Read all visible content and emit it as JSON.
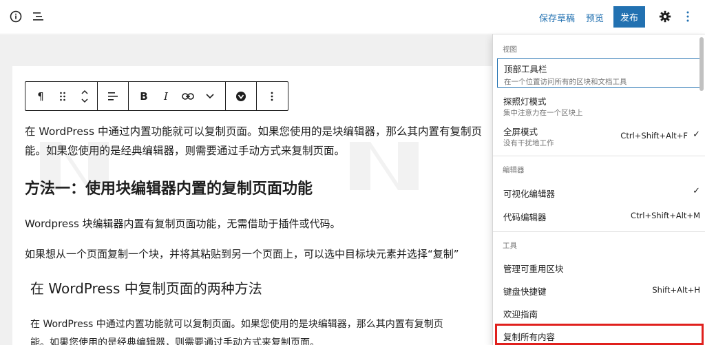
{
  "topbar": {
    "save_draft": "保存草稿",
    "preview": "预览",
    "publish": "发布",
    "icons": [
      "info-icon",
      "list-view-icon",
      "gear-icon",
      "more-vertical-icon"
    ]
  },
  "block_toolbar": {
    "paragraph_symbol": "¶",
    "bold": "B",
    "italic": "I"
  },
  "content": {
    "para1_line1": "在 WordPress 中通过内置功能就可以复制页面。如果您使用的是块编辑器，那么其内置有复制页",
    "para1_line2": "能。如果您使用的是经典编辑器，则需要通过手动方式来复制页面。",
    "heading1": "方法一：使用块编辑器内置的复制页面功能",
    "para2": "Wordpress 块编辑器内置有复制页面功能，无需借助于插件或代码。",
    "para3": "如果想从一个页面复制一个块，并将其粘贴到另一个页面上，可以选中目标块元素并选择“复制”",
    "heading2": "在 WordPress 中复制页面的两种方法",
    "para4_line1": "在 WordPress 中通过内置功能就可以复制页面。如果您使用的是块编辑器，那么其内置有复制页",
    "para4_line2": "能。如果您使用的是经典编辑器，则需要通过手动方式来复制页面。"
  },
  "menu": {
    "section_view": "视图",
    "top_toolbar": {
      "label": "顶部工具栏",
      "desc": "在一个位置访问所有的区块和文档工具"
    },
    "spotlight": {
      "label": "探照灯模式",
      "desc": "集中注意力在一个区块上"
    },
    "fullscreen": {
      "label": "全屏模式",
      "desc": "没有干扰地工作",
      "shortcut": "Ctrl+Shift+Alt+F",
      "check": "✓"
    },
    "section_editor": "编辑器",
    "visual_editor": {
      "label": "可视化编辑器",
      "check": "✓"
    },
    "code_editor": {
      "label": "代码编辑器",
      "shortcut": "Ctrl+Shift+Alt+M"
    },
    "section_tools": "工具",
    "reusable_blocks": {
      "label": "管理可重用区块"
    },
    "keyboard_shortcuts": {
      "label": "键盘快捷键",
      "shortcut": "Shift+Alt+H"
    },
    "welcome_guide": {
      "label": "欢迎指南"
    },
    "copy_all": {
      "label": "复制所有内容"
    }
  },
  "colors": {
    "accent": "#2271b1",
    "highlight": "#e0201d"
  }
}
